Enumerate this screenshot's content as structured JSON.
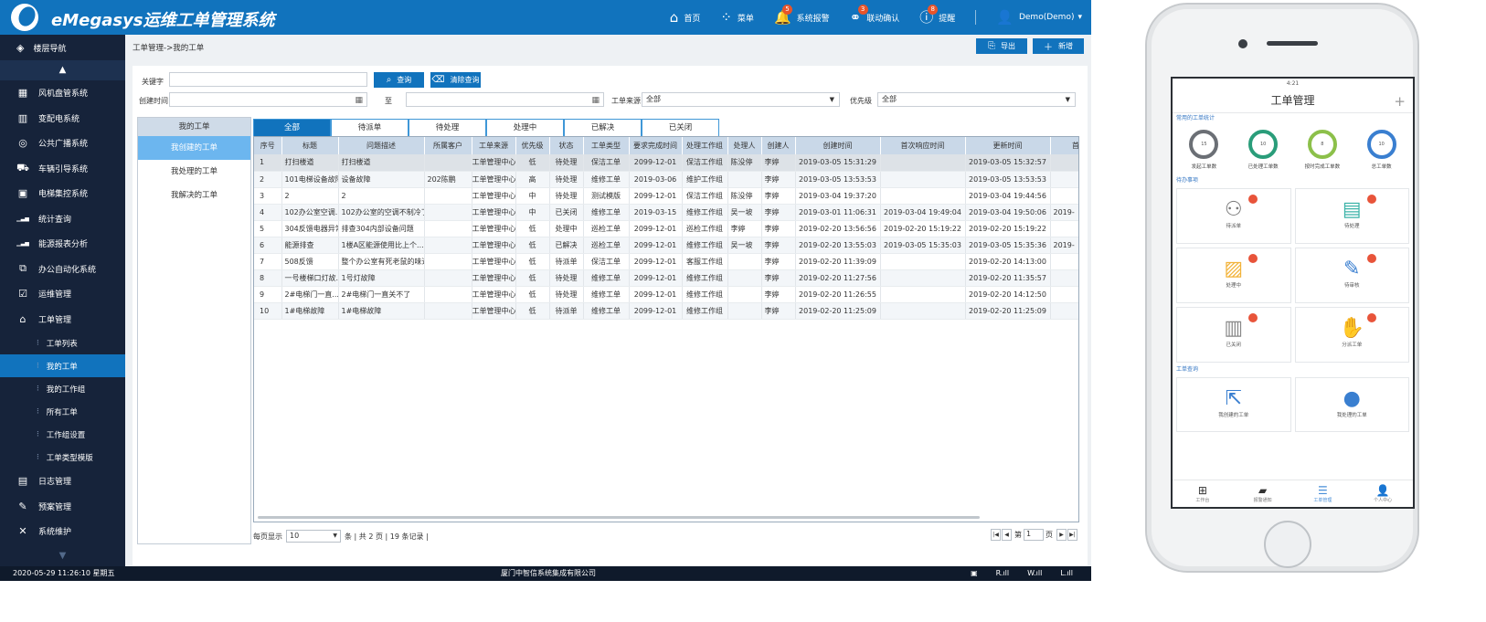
{
  "app": {
    "title": "eMegasys运维工单管理系统",
    "nav": [
      {
        "label": "首页",
        "icon": "home-icon",
        "glyph": "⌂",
        "badge": ""
      },
      {
        "label": "菜单",
        "icon": "grid-menu-icon",
        "glyph": "⁘",
        "badge": ""
      },
      {
        "label": "系统报警",
        "icon": "bell-icon",
        "glyph": "🔔",
        "badge": "5"
      },
      {
        "label": "联动确认",
        "icon": "link-icon",
        "glyph": "⚭",
        "badge": "3"
      },
      {
        "label": "提醒",
        "icon": "alert-icon",
        "glyph": "ⓘ",
        "badge": "8"
      },
      {
        "label": "Demo(Demo)",
        "icon": "user-icon",
        "glyph": "👤",
        "badge": ""
      }
    ]
  },
  "sidebar": {
    "header": "楼层导航",
    "items": [
      {
        "label": "风机盘管系统",
        "icon": "fan-coil-icon",
        "glyph": "▦"
      },
      {
        "label": "变配电系统",
        "icon": "power-icon",
        "glyph": "▥"
      },
      {
        "label": "公共广播系统",
        "icon": "broadcast-icon",
        "glyph": "◎"
      },
      {
        "label": "车辆引导系统",
        "icon": "car-icon",
        "glyph": "⛟"
      },
      {
        "label": "电梯集控系统",
        "icon": "elevator-icon",
        "glyph": "▣"
      },
      {
        "label": "统计查询",
        "icon": "bar-chart-icon",
        "glyph": "▁▃▅"
      },
      {
        "label": "能源报表分析",
        "icon": "report-chart-icon",
        "glyph": "▁▃▅"
      },
      {
        "label": "办公自动化系统",
        "icon": "office-icon",
        "glyph": "⧉"
      },
      {
        "label": "运维管理",
        "icon": "check-box-icon",
        "glyph": "☑"
      },
      {
        "label": "工单管理",
        "icon": "graduation-icon",
        "glyph": "⌂"
      }
    ],
    "subitems": [
      "工单列表",
      "我的工单",
      "我的工作组",
      "所有工单",
      "工作组设置",
      "工单类型模版"
    ],
    "items_after": [
      {
        "label": "日志管理",
        "icon": "log-icon",
        "glyph": "▤"
      },
      {
        "label": "预案管理",
        "icon": "plan-icon",
        "glyph": "✎"
      },
      {
        "label": "系统维护",
        "icon": "tools-icon",
        "glyph": "✕"
      }
    ]
  },
  "footer": {
    "datetime": "2020-05-29  11:26:10  星期五",
    "company": "厦门中智信系统集成有限公司",
    "signals": [
      "R.ıll",
      "W.ıll",
      "L.ıll"
    ]
  },
  "main": {
    "breadcrumb": "工单管理->我的工单",
    "export_label": "导出",
    "new_label": "新增",
    "filters": {
      "keyword_label": "关键字",
      "keyword_value": "",
      "search_label": "查询",
      "clear_label": "清除查询",
      "created_label": "创建时间",
      "to_label": "至",
      "source_label": "工单来源",
      "source_value": "全部",
      "priority_label": "优先级",
      "priority_value": "全部"
    },
    "left_panel": {
      "title": "我的工单",
      "items": [
        "我创建的工单",
        "我处理的工单",
        "我解决的工单"
      ]
    },
    "tabs": [
      "全部",
      "待派单",
      "待处理",
      "处理中",
      "已解决",
      "已关闭"
    ],
    "columns": [
      "序号",
      "标题",
      "问题描述",
      "所属客户",
      "工单来源",
      "优先级",
      "状态",
      "工单类型",
      "要求完成时间",
      "处理工作组",
      "处理人",
      "创建人",
      "创建时间",
      "首次响应时间",
      "更新时间",
      "首次"
    ],
    "rows": [
      [
        "1",
        "打扫楼道",
        "打扫楼道",
        "",
        "工单管理中心",
        "低",
        "待处理",
        "保洁工单",
        "2099-12-01",
        "保洁工作组",
        "陈没停",
        "李婷",
        "2019-03-05 15:31:29",
        "",
        "2019-03-05 15:32:57",
        ""
      ],
      [
        "2",
        "101电梯设备故障",
        "设备故障",
        "202陈鹏",
        "工单管理中心",
        "高",
        "待处理",
        "维修工单",
        "2019-03-06",
        "维护工作组",
        "",
        "李婷",
        "2019-03-05 13:53:53",
        "",
        "2019-03-05 13:53:53",
        ""
      ],
      [
        "3",
        "2",
        "2",
        "",
        "工单管理中心",
        "中",
        "待处理",
        "测试模版",
        "2099-12-01",
        "保洁工作组",
        "陈没停",
        "李婷",
        "2019-03-04 19:37:20",
        "",
        "2019-03-04 19:44:56",
        ""
      ],
      [
        "4",
        "102办公室空调...",
        "102办公室的空调不制冷了",
        "",
        "工单管理中心",
        "中",
        "已关闭",
        "维修工单",
        "2019-03-15",
        "维修工作组",
        "吴一坡",
        "李婷",
        "2019-03-01 11:06:31",
        "2019-03-04 19:49:04",
        "2019-03-04 19:50:06",
        "2019-"
      ],
      [
        "5",
        "304反馈电器异常",
        "排查304内部设备问题",
        "",
        "工单管理中心",
        "低",
        "处理中",
        "巡检工单",
        "2099-12-01",
        "巡检工作组",
        "李婷",
        "李婷",
        "2019-02-20 13:56:56",
        "2019-02-20 15:19:22",
        "2019-02-20 15:19:22",
        ""
      ],
      [
        "6",
        "能源排查",
        "1楼A区能源使用比上个...",
        "",
        "工单管理中心",
        "低",
        "已解决",
        "巡检工单",
        "2099-12-01",
        "维修工作组",
        "吴一坡",
        "李婷",
        "2019-02-20 13:55:03",
        "2019-03-05 15:35:03",
        "2019-03-05 15:35:36",
        "2019-"
      ],
      [
        "7",
        "508反馈",
        "整个办公室有死老鼠的味道",
        "",
        "工单管理中心",
        "低",
        "待派单",
        "保洁工单",
        "2099-12-01",
        "客服工作组",
        "",
        "李婷",
        "2019-02-20 11:39:09",
        "",
        "2019-02-20 14:13:00",
        ""
      ],
      [
        "8",
        "一号楼梯口灯故...",
        "1号灯故障",
        "",
        "工单管理中心",
        "低",
        "待处理",
        "维修工单",
        "2099-12-01",
        "维修工作组",
        "",
        "李婷",
        "2019-02-20 11:27:56",
        "",
        "2019-02-20 11:35:57",
        ""
      ],
      [
        "9",
        "2#电梯门一直...",
        "2#电梯门一直关不了",
        "",
        "工单管理中心",
        "低",
        "待处理",
        "维修工单",
        "2099-12-01",
        "维修工作组",
        "",
        "李婷",
        "2019-02-20 11:26:55",
        "",
        "2019-02-20 14:12:50",
        ""
      ],
      [
        "10",
        "1#电梯故障",
        "1#电梯故障",
        "",
        "工单管理中心",
        "低",
        "待派单",
        "维修工单",
        "2099-12-01",
        "维修工作组",
        "",
        "李婷",
        "2019-02-20 11:25:09",
        "",
        "2019-02-20 11:25:09",
        ""
      ]
    ],
    "pager": {
      "per_page_label": "每页显示",
      "per_page_value": "10",
      "summary": "条 | 共 2 页 | 19 条记录 |",
      "page_prefix": "第",
      "page_value": "1",
      "page_suffix": "页"
    }
  },
  "phone": {
    "status": "4:21",
    "title": "工单管理",
    "section1": "常用的工单统计",
    "stats": [
      {
        "value": "15",
        "label": "发起工单数",
        "color": "#6b6f75"
      },
      {
        "value": "10",
        "label": "已处理工单数",
        "color": "#2a9d7a"
      },
      {
        "value": "8",
        "label": "按时完成工单数",
        "color": "#8cc04a"
      },
      {
        "value": "10",
        "label": "总工单数",
        "color": "#3a7fd0"
      }
    ],
    "section2": "待办事项",
    "tasks": [
      {
        "label": "待派单",
        "icon": "dispatch-person-icon",
        "glyph": "⚇",
        "color": "#777"
      },
      {
        "label": "待处理",
        "icon": "pending-doc-icon",
        "glyph": "▤",
        "color": "#3bb3a8"
      },
      {
        "label": "处理中",
        "icon": "processing-doc-icon",
        "glyph": "▨",
        "color": "#f2b33a"
      },
      {
        "label": "待审核",
        "icon": "review-edit-icon",
        "glyph": "✎",
        "color": "#3a7fd0"
      },
      {
        "label": "已关闭",
        "icon": "closed-doc-icon",
        "glyph": "▥",
        "color": "#888"
      },
      {
        "label": "分派工单",
        "icon": "assign-hand-icon",
        "glyph": "✋",
        "color": "#3bb3a8"
      }
    ],
    "section3": "工单查询",
    "queries": [
      {
        "label": "我创建的工单",
        "icon": "share-icon",
        "glyph": "⇱",
        "color": "#3a7fd0"
      },
      {
        "label": "我处理的工单",
        "icon": "person-circle-icon",
        "glyph": "●",
        "color": "#3a7fd0"
      }
    ],
    "tabbar": [
      "工作台",
      "报警通知",
      "工单管理",
      "个人中心"
    ]
  }
}
